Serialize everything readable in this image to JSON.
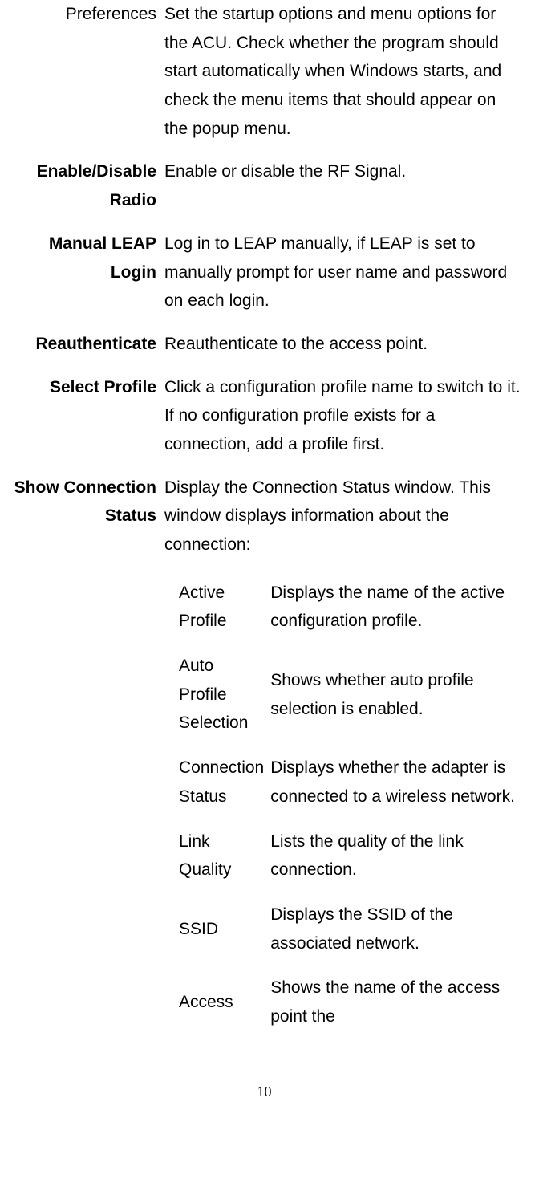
{
  "rows": [
    {
      "labelBold": false,
      "label": "Preferences",
      "desc": "Set the startup options and menu options for the ACU. Check whether the program should start automatically when Windows starts, and check the menu items that should appear on the popup menu."
    },
    {
      "labelBold": true,
      "label": "Enable/Disable Radio",
      "desc": "Enable or disable the RF Signal."
    },
    {
      "labelBold": true,
      "label": "Manual LEAP Login",
      "desc": "Log in to LEAP manually, if LEAP is set to manually prompt for user name and password on each login."
    },
    {
      "labelBold": true,
      "label": "Reauthenticate",
      "desc": "Reauthenticate to the access point."
    },
    {
      "labelBold": true,
      "label": "Select Profile",
      "desc": "Click a configuration profile name to switch to it. If no configuration profile exists for a connection, add a profile first."
    },
    {
      "labelBold": true,
      "label": "Show Connection Status",
      "desc": "Display the Connection Status window.   This window displays information about the connection:"
    }
  ],
  "subrows": [
    {
      "label": "Active Profile",
      "desc": "Displays the name of the active configuration profile."
    },
    {
      "label": "Auto Profile Selection",
      "desc": "Shows whether auto profile selection is enabled."
    },
    {
      "label": "Connection Status",
      "desc": "Displays whether the adapter is connected to a wireless network."
    },
    {
      "label": "Link Quality",
      "desc": "Lists the quality of the link connection."
    },
    {
      "label": "SSID",
      "desc": "Displays the SSID of the associated network."
    },
    {
      "label": "Access",
      "desc": "Shows the name of the access point the"
    }
  ],
  "pageNumber": "10"
}
